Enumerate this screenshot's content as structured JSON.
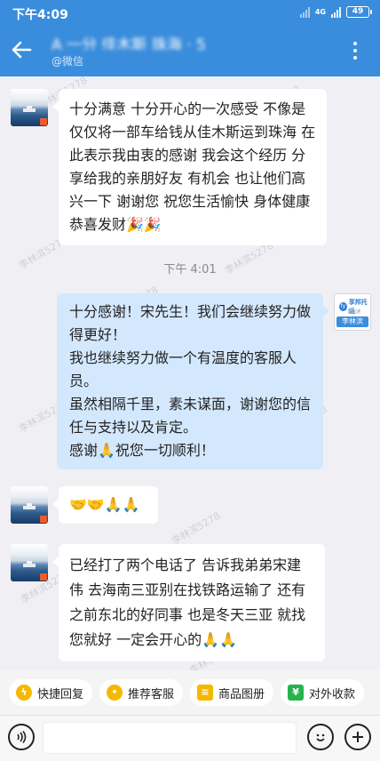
{
  "status_bar": {
    "time": "下午4:09",
    "network": "4G",
    "battery": "49"
  },
  "header": {
    "title": "A 一分 佳木斯 珠海 · 5",
    "subtitle": "@微信"
  },
  "messages": [
    {
      "side": "in",
      "text": "十分满意 十分开心的一次感受 不像是仅仅将一部车给钱从佳木斯运到珠海 在此表示我由衷的感谢 我会这个经历 分享给我的亲朋好友 有机会 也让他们高兴一下 谢谢您 祝您生活愉快 身体健康 恭喜发财🎉🎉"
    },
    {
      "side": "time",
      "text": "下午 4:01"
    },
    {
      "side": "out",
      "lines": [
        "十分感谢！宋先生！我们会继续努力做得更好！",
        "我也继续努力做一个有温度的客服人员。",
        "虽然相隔千里，素未谋面，谢谢您的信任与支持以及肯定。",
        "感谢🙏祝您一切顺利！"
      ]
    },
    {
      "side": "in",
      "text": "🤝🤝🙏🙏"
    },
    {
      "side": "in",
      "text": "已经打了两个电话了 告诉我弟弟宋建伟 去海南三亚别在找铁路运输了 还有之前东北的好同事 也是冬天三亚 就找您就好 一定会开心的🙏🙏"
    }
  ],
  "agent_avatar": {
    "brand": "享邦托运",
    "sub": "车运通",
    "tag": "李林滨"
  },
  "watermark": "李林滨5278",
  "quick_actions": [
    {
      "label": "快捷回复",
      "icon": "lightning-icon"
    },
    {
      "label": "推荐客服",
      "icon": "recommend-icon"
    },
    {
      "label": "商品图册",
      "icon": "catalog-icon"
    },
    {
      "label": "对外收款",
      "icon": "payment-icon"
    }
  ],
  "colors": {
    "header": "#3a8ddc",
    "outgoing_bubble": "#d4e8fd",
    "incoming_bubble": "#ffffff",
    "background": "#efeff4"
  }
}
